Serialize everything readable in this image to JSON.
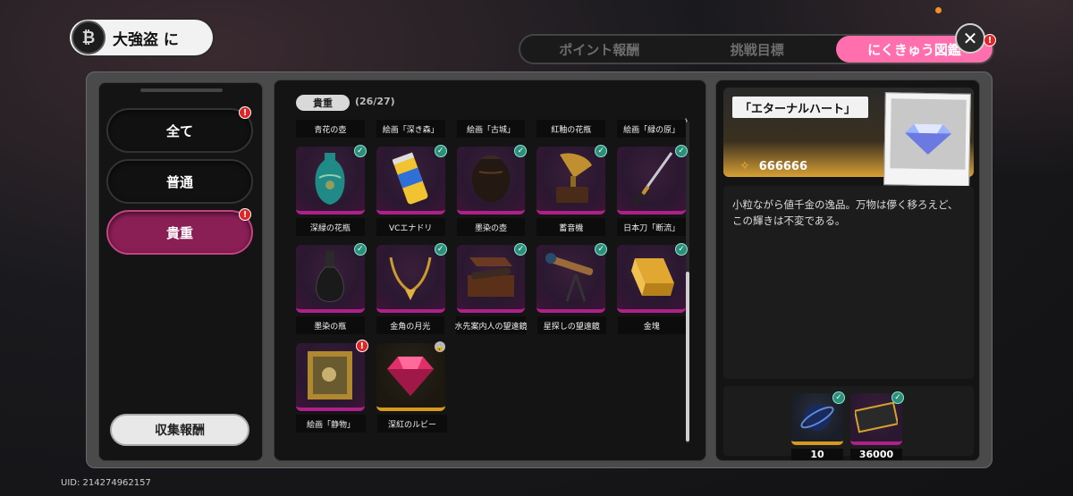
{
  "event": {
    "title": "大強盗 に",
    "logo_glyph": "₿"
  },
  "tabs": [
    {
      "label": "ポイント報酬"
    },
    {
      "label": "挑戦目標"
    },
    {
      "label": "にくきゅう図鑑"
    }
  ],
  "close_glyph": "✕",
  "categories": [
    {
      "label": "全て",
      "badge": "!"
    },
    {
      "label": "普通"
    },
    {
      "label": "貴重",
      "badge": "!"
    }
  ],
  "collect_button": "収集報酬",
  "filter": {
    "label": "貴重",
    "count": "(26/27)"
  },
  "top_labels": [
    "青花の壺",
    "絵画「深き森」",
    "絵画「古城」",
    "紅釉の花瓶",
    "絵画「緑の原」"
  ],
  "rows": [
    {
      "items": [
        {
          "art": "vase-teal"
        },
        {
          "art": "can"
        },
        {
          "art": "pot-black"
        },
        {
          "art": "gramophone"
        },
        {
          "art": "katana"
        }
      ],
      "labels": [
        "深緑の花瓶",
        "VCエナドリ",
        "墨染の壺",
        "蓄音機",
        "日本刀「断流」"
      ]
    },
    {
      "items": [
        {
          "art": "flask"
        },
        {
          "art": "necklace"
        },
        {
          "art": "spyglass-box"
        },
        {
          "art": "telescope"
        },
        {
          "art": "gold-bar"
        }
      ],
      "labels": [
        "墨染の瓶",
        "金角の月光",
        "水先案内人の望遠鏡",
        "星探しの望遠鏡",
        "金塊"
      ]
    },
    {
      "items": [
        {
          "art": "painting"
        },
        {
          "art": "ruby"
        }
      ],
      "labels": [
        "絵画「静物」",
        "深紅のルビー"
      ]
    }
  ],
  "detail": {
    "name": "「エターナルハート」",
    "price": "666666",
    "description": "小粒ながら値千金の逸品。万物は儚く移ろえど、この輝きは不変である。"
  },
  "rewards": [
    {
      "qty": "10"
    },
    {
      "qty": "36000"
    }
  ],
  "uid": "UID: 214274962157",
  "colors": {
    "accent_pink": "#ff6fae",
    "rare_magenta": "#b0208a",
    "gold": "#d89a1c"
  }
}
